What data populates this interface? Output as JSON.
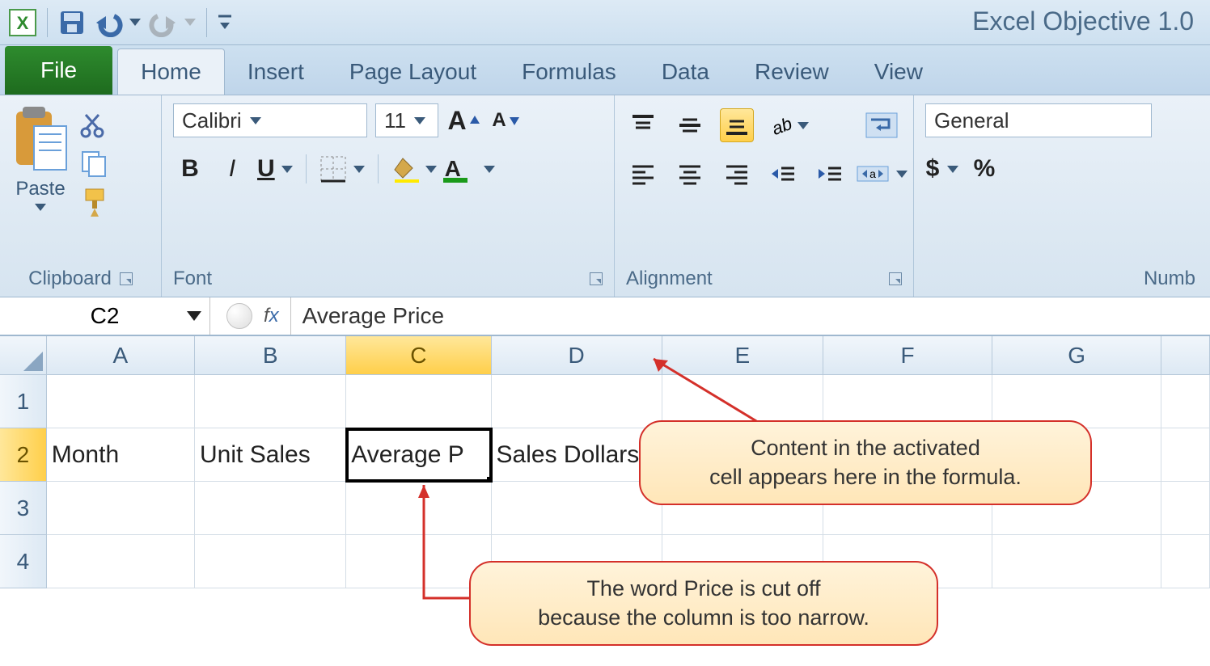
{
  "app_title": "Excel Objective 1.0",
  "qat": {
    "save": "Save",
    "undo": "Undo",
    "redo": "Redo"
  },
  "tabs": {
    "file": "File",
    "items": [
      "Home",
      "Insert",
      "Page Layout",
      "Formulas",
      "Data",
      "Review",
      "View"
    ],
    "active": "Home"
  },
  "ribbon": {
    "clipboard": {
      "label": "Clipboard",
      "paste": "Paste"
    },
    "font": {
      "label": "Font",
      "name": "Calibri",
      "size": "11",
      "bold": "B",
      "italic": "I",
      "underline": "U"
    },
    "alignment": {
      "label": "Alignment"
    },
    "number": {
      "label": "Numb",
      "format": "General",
      "currency": "$",
      "percent": "%"
    }
  },
  "formula_bar": {
    "name_box": "C2",
    "fx": "fx",
    "content": "Average Price"
  },
  "columns": [
    "A",
    "B",
    "C",
    "D",
    "E",
    "F",
    "G"
  ],
  "active_col": "C",
  "rows": [
    "1",
    "2",
    "3",
    "4"
  ],
  "active_row": "2",
  "cells": {
    "A2": "Month",
    "B2": "Unit Sales",
    "C2_display": "Average P",
    "C2_full": "Average Price",
    "D2": "Sales Dollars"
  },
  "callouts": {
    "c1_line1": "Content in the activated",
    "c1_line2": "cell appears here in the formula.",
    "c2_line1": "The word Price is cut off",
    "c2_line2": "because the column is too narrow."
  }
}
